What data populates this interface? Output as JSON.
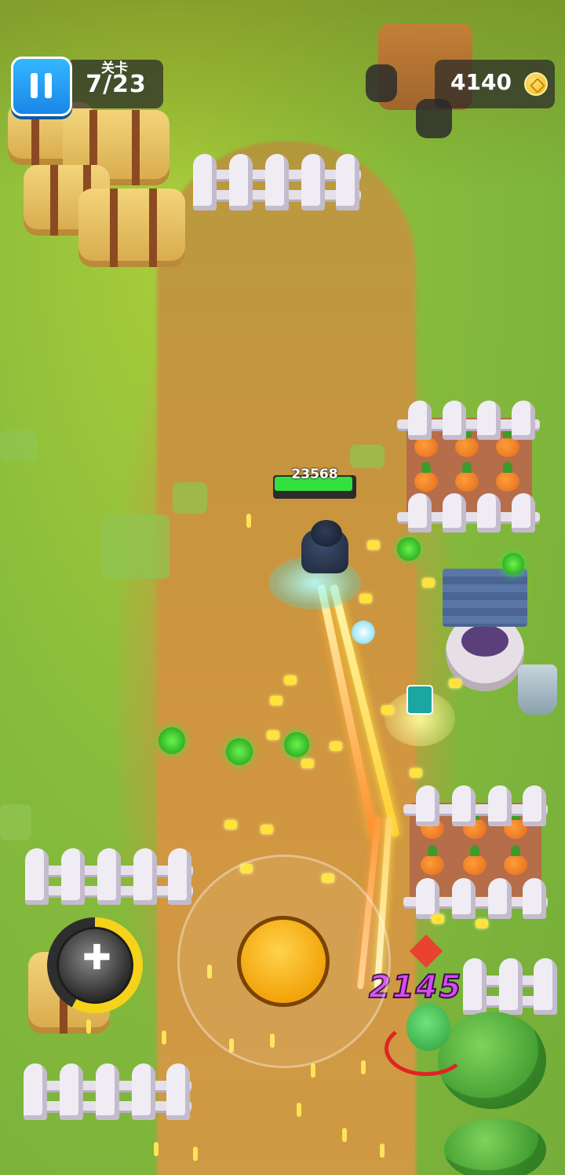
{
  "hud": {
    "level_label": "关卡",
    "level_value": "7/23",
    "coins": "4140"
  },
  "player": {
    "health": "23568",
    "health_fraction": 0.97
  },
  "combat": {
    "damage_number": "2145"
  },
  "skill": {
    "charge_fraction": 0.58
  },
  "icons": {
    "pause": "pause-icon",
    "coin": "coin-icon",
    "skill": "plus-orb-icon"
  },
  "colors": {
    "pause_button": "#1a86e6",
    "health_bar": "#33e03d",
    "damage_text": "#d54bf0",
    "joystick": "#f2a40b",
    "skill_charge": "#f6d21a"
  }
}
